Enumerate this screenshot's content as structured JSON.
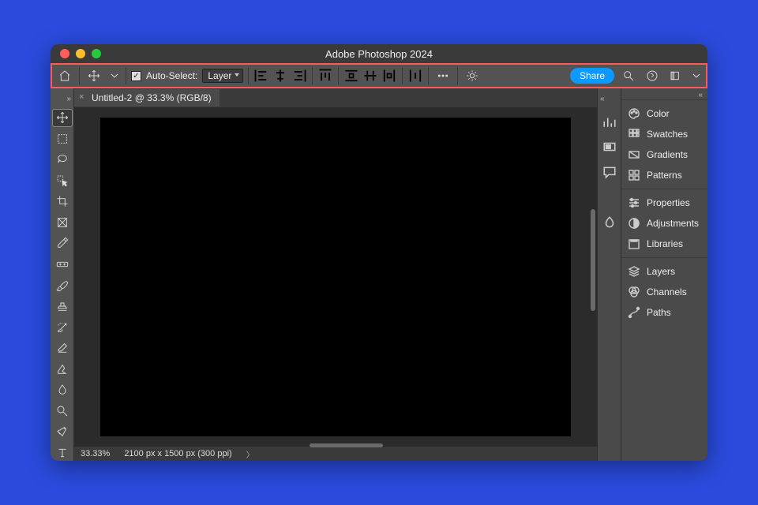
{
  "window": {
    "title": "Adobe Photoshop 2024"
  },
  "options_bar": {
    "auto_select": {
      "label": "Auto-Select:",
      "checked": true
    },
    "layer_dropdown": {
      "value": "Layer"
    },
    "share_label": "Share"
  },
  "document": {
    "tab_label": "Untitled-2 @ 33.3% (RGB/8)"
  },
  "status_bar": {
    "zoom": "33.33%",
    "dimensions": "2100 px x 1500 px (300 ppi)"
  },
  "toolbox": {
    "tools": [
      "move-tool",
      "marquee-tool",
      "lasso-tool",
      "object-select-tool",
      "crop-tool",
      "frame-tool",
      "eyedropper-tool",
      "healing-brush-tool",
      "brush-tool",
      "clone-stamp-tool",
      "history-brush-tool",
      "eraser-tool",
      "gradient-tool",
      "blur-tool",
      "dodge-tool",
      "pen-tool",
      "type-tool"
    ]
  },
  "panels": {
    "group1": [
      {
        "name": "color",
        "label": "Color"
      },
      {
        "name": "swatches",
        "label": "Swatches"
      },
      {
        "name": "gradients",
        "label": "Gradients"
      },
      {
        "name": "patterns",
        "label": "Patterns"
      }
    ],
    "group2": [
      {
        "name": "properties",
        "label": "Properties"
      },
      {
        "name": "adjustments",
        "label": "Adjustments"
      },
      {
        "name": "libraries",
        "label": "Libraries"
      }
    ],
    "group3": [
      {
        "name": "layers",
        "label": "Layers"
      },
      {
        "name": "channels",
        "label": "Channels"
      },
      {
        "name": "paths",
        "label": "Paths"
      }
    ]
  },
  "colors": {
    "background": "#2a4bdd",
    "highlight": "#ff5a5a",
    "share_button": "#0d99ff"
  }
}
